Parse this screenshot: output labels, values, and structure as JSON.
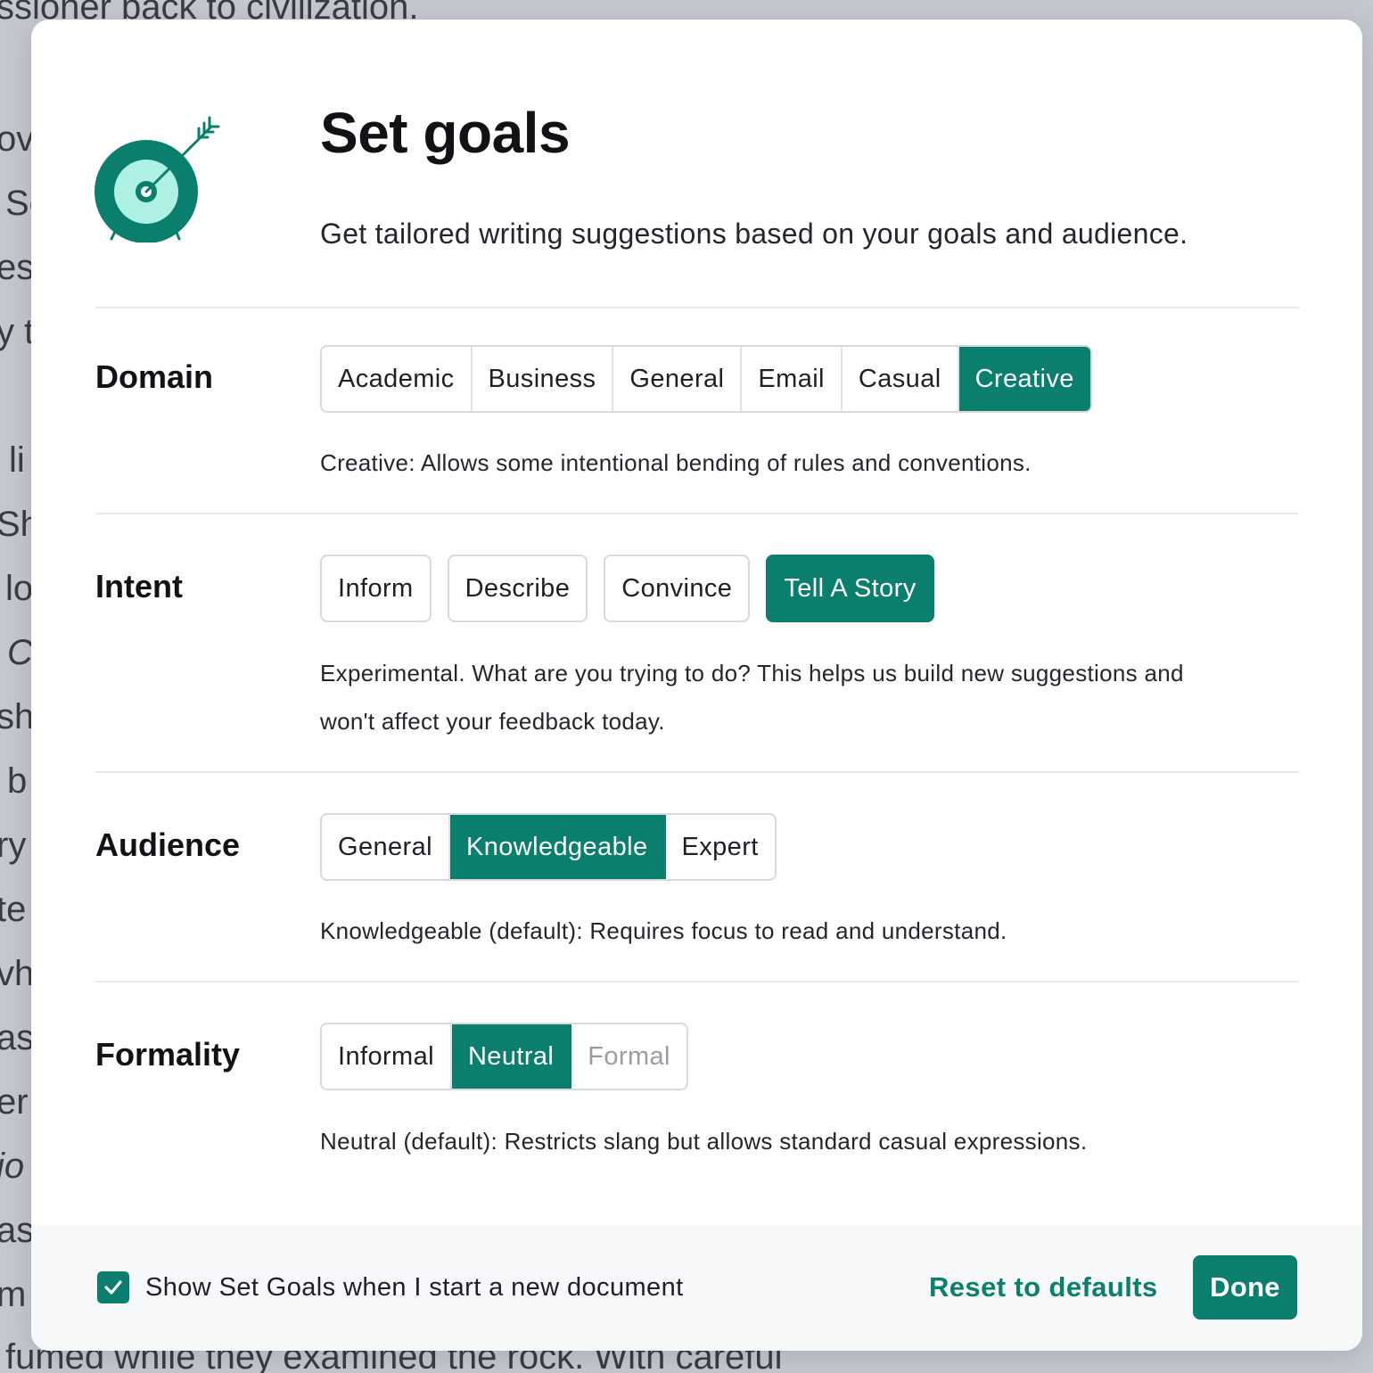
{
  "background_document": {
    "top_line": "ssioner back to civilization.",
    "bottom_line": "fumed while they examined the rock. With careful",
    "left_fragments": [
      "ov",
      "Sc",
      "est",
      "y t",
      "li",
      "Sh",
      "lo",
      "C",
      "sh",
      "b",
      "ry",
      "te",
      "vh",
      "as",
      "er",
      "jo",
      "as",
      "m"
    ]
  },
  "dialog": {
    "title": "Set goals",
    "subtitle": "Get tailored writing suggestions based on your goals and audience.",
    "logo_icon": "target-with-arrow-icon"
  },
  "colors": {
    "accent": "#0b7f6e",
    "accent_light": "#aef0e4"
  },
  "domain": {
    "label": "Domain",
    "options": [
      "Academic",
      "Business",
      "General",
      "Email",
      "Casual",
      "Creative"
    ],
    "selected": "Creative",
    "description": "Creative: Allows some intentional bending of rules and conventions."
  },
  "intent": {
    "label": "Intent",
    "options": [
      "Inform",
      "Describe",
      "Convince",
      "Tell A Story"
    ],
    "selected": "Tell A Story",
    "description_line1": "Experimental. What are you trying to do? This helps us build new suggestions and",
    "description_line2": "won't affect your feedback today."
  },
  "audience": {
    "label": "Audience",
    "options": [
      "General",
      "Knowledgeable",
      "Expert"
    ],
    "selected": "Knowledgeable",
    "description": "Knowledgeable (default): Requires focus to read and understand."
  },
  "formality": {
    "label": "Formality",
    "options": [
      "Informal",
      "Neutral",
      "Formal"
    ],
    "selected": "Neutral",
    "disabled": "Formal",
    "description": "Neutral (default): Restricts slang but allows standard casual expressions."
  },
  "footer": {
    "checkbox_label": "Show Set Goals when I start a new document",
    "checkbox_checked": true,
    "reset_label": "Reset to defaults",
    "done_label": "Done"
  }
}
